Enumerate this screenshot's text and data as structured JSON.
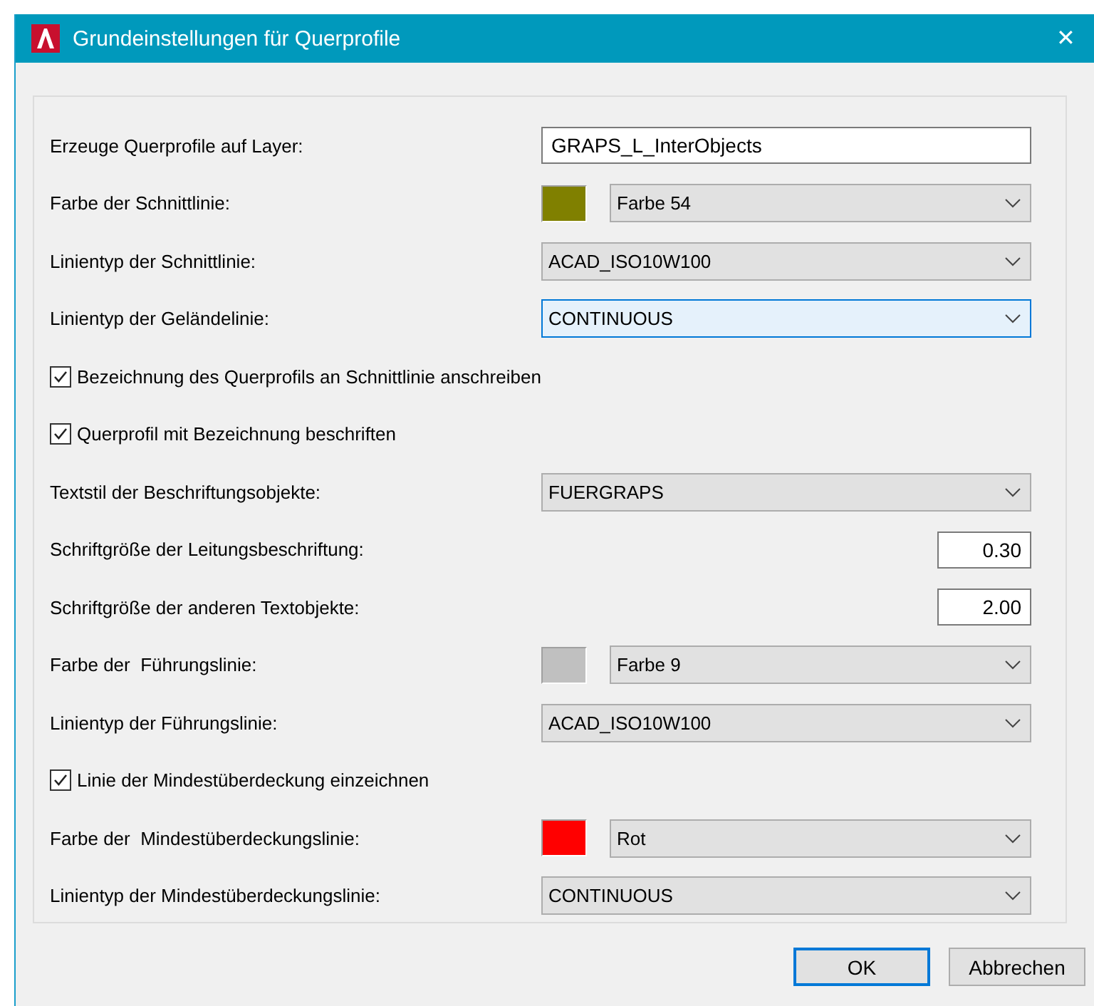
{
  "window": {
    "title": "Grundeinstellungen für Querprofile",
    "close": "✕"
  },
  "fields": [
    {
      "kind": "text",
      "label": "Erzeuge Querprofile auf Layer:",
      "value": "GRAPS_L_InterObjects"
    },
    {
      "kind": "color",
      "label": "Farbe der Schnittlinie:",
      "color": "#808000",
      "value": "Farbe 54",
      "focused": false
    },
    {
      "kind": "combo",
      "label": "Linientyp der Schnittlinie:",
      "value": "ACAD_ISO10W100",
      "focused": false
    },
    {
      "kind": "combo",
      "label": "Linientyp der Geländelinie:",
      "value": "CONTINUOUS",
      "focused": true
    },
    {
      "kind": "checkbox",
      "label": "Bezeichnung des Querprofils an Schnittlinie anschreiben",
      "checked": true
    },
    {
      "kind": "checkbox",
      "label": "Querprofil mit Bezeichnung beschriften",
      "checked": true
    },
    {
      "kind": "combo",
      "label": "Textstil der Beschriftungsobjekte:",
      "value": "FUERGRAPS",
      "focused": false
    },
    {
      "kind": "number",
      "label": "Schriftgröße der Leitungsbeschriftung:",
      "value": "0.30"
    },
    {
      "kind": "number",
      "label": "Schriftgröße der anderen Textobjekte:",
      "value": "2.00"
    },
    {
      "kind": "color",
      "label": "Farbe der  Führungslinie:",
      "color": "#c0c0c0",
      "value": "Farbe 9",
      "focused": false
    },
    {
      "kind": "combo",
      "label": "Linientyp der Führungslinie:",
      "value": "ACAD_ISO10W100",
      "focused": false
    },
    {
      "kind": "checkbox",
      "label": "Linie der Mindestüberdeckung einzeichnen",
      "checked": true
    },
    {
      "kind": "color",
      "label": "Farbe der  Mindestüberdeckungslinie:",
      "color": "#ff0000",
      "value": "Rot",
      "focused": false
    },
    {
      "kind": "combo",
      "label": "Linientyp der Mindestüberdeckungslinie:",
      "value": "CONTINUOUS",
      "focused": false
    }
  ],
  "buttons": [
    {
      "label": "OK",
      "default": true
    },
    {
      "label": "Abbrechen",
      "default": false
    }
  ]
}
